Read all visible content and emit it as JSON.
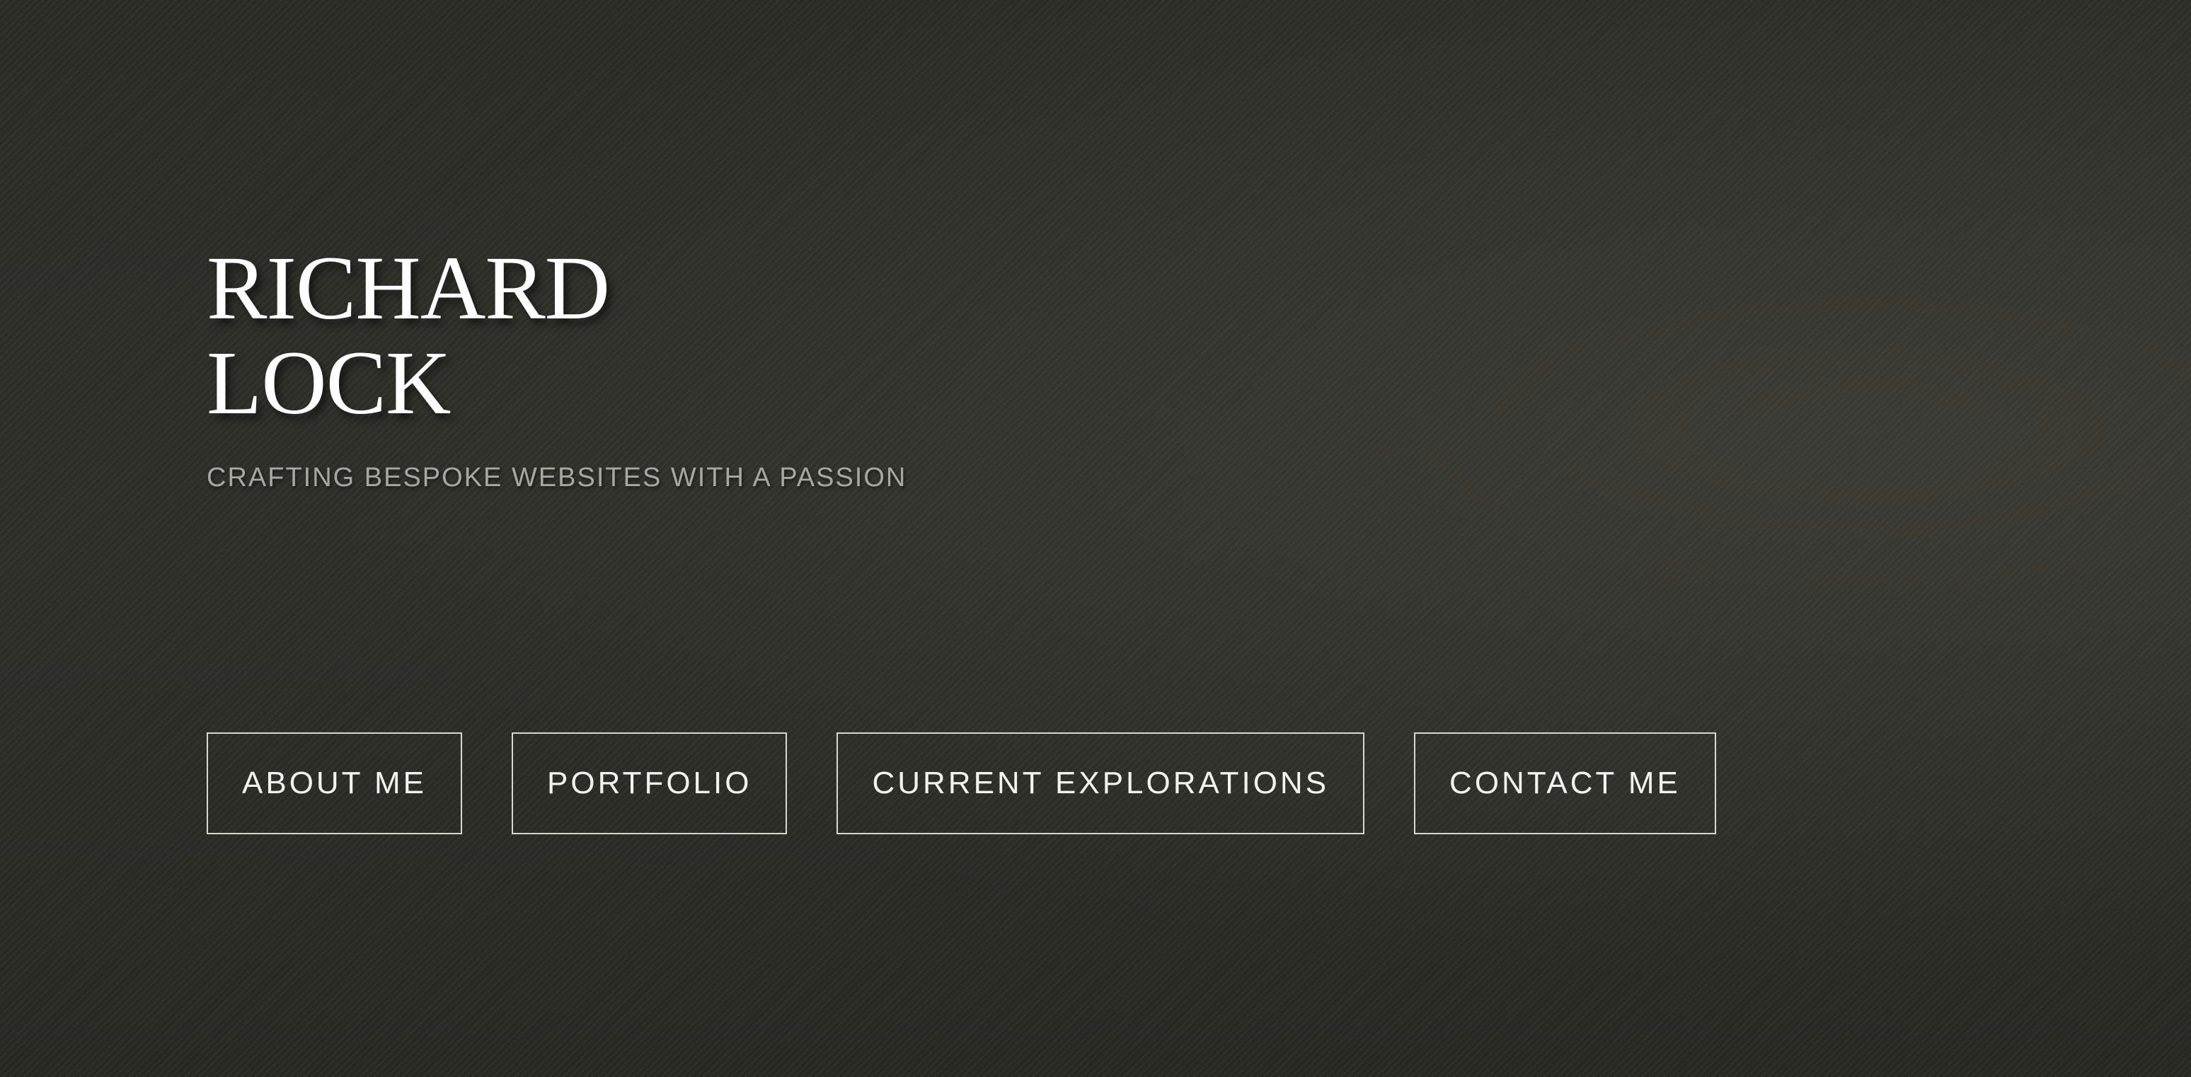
{
  "hero": {
    "name_line1": "RICHARD",
    "name_line2": "LOCK",
    "tagline": "CRAFTING BESPOKE WEBSITES WITH A PASSION"
  },
  "nav": {
    "items": [
      {
        "label": "ABOUT ME"
      },
      {
        "label": "PORTFOLIO"
      },
      {
        "label": "CURRENT EXPLORATIONS"
      },
      {
        "label": "CONTACT ME"
      }
    ]
  },
  "colors": {
    "background": "#2c2c27",
    "text": "#ffffff",
    "tagline": "#a8a8a2",
    "button_border": "#d8d8d2"
  }
}
